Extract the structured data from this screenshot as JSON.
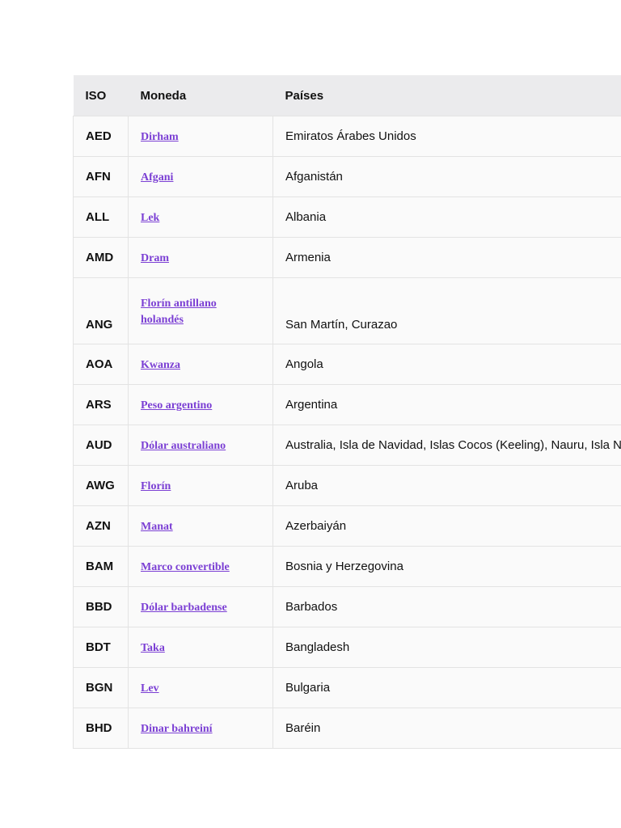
{
  "table": {
    "headers": {
      "iso": "ISO",
      "currency": "Moneda",
      "countries": "Países"
    },
    "rows": [
      {
        "iso": "AED",
        "currency": "Dirham",
        "countries": "Emiratos Árabes Unidos"
      },
      {
        "iso": "AFN",
        "currency": "Afgani",
        "countries": "Afganistán"
      },
      {
        "iso": "ALL",
        "currency": "Lek",
        "countries": "Albania"
      },
      {
        "iso": "AMD",
        "currency": "Dram",
        "countries": "Armenia"
      },
      {
        "iso": "ANG",
        "currency": "Florín antillano holandés",
        "countries": "San Martín, Curazao"
      },
      {
        "iso": "AOA",
        "currency": "Kwanza",
        "countries": "Angola"
      },
      {
        "iso": "ARS",
        "currency": "Peso argentino",
        "countries": "Argentina"
      },
      {
        "iso": "AUD",
        "currency": "Dólar australiano",
        "countries": "Australia, Isla de Navidad, Islas Cocos (Keeling), Nauru, Isla N"
      },
      {
        "iso": "AWG",
        "currency": "Florín",
        "countries": "Aruba"
      },
      {
        "iso": "AZN",
        "currency": "Manat",
        "countries": "Azerbaiyán"
      },
      {
        "iso": "BAM",
        "currency": "Marco convertible",
        "countries": "Bosnia y Herzegovina"
      },
      {
        "iso": "BBD",
        "currency": "Dólar barbadense",
        "countries": "Barbados"
      },
      {
        "iso": "BDT",
        "currency": "Taka",
        "countries": "Bangladesh"
      },
      {
        "iso": "BGN",
        "currency": "Lev",
        "countries": "Bulgaria"
      },
      {
        "iso": "BHD",
        "currency": "Dinar bahreiní",
        "countries": "Baréin"
      }
    ]
  }
}
